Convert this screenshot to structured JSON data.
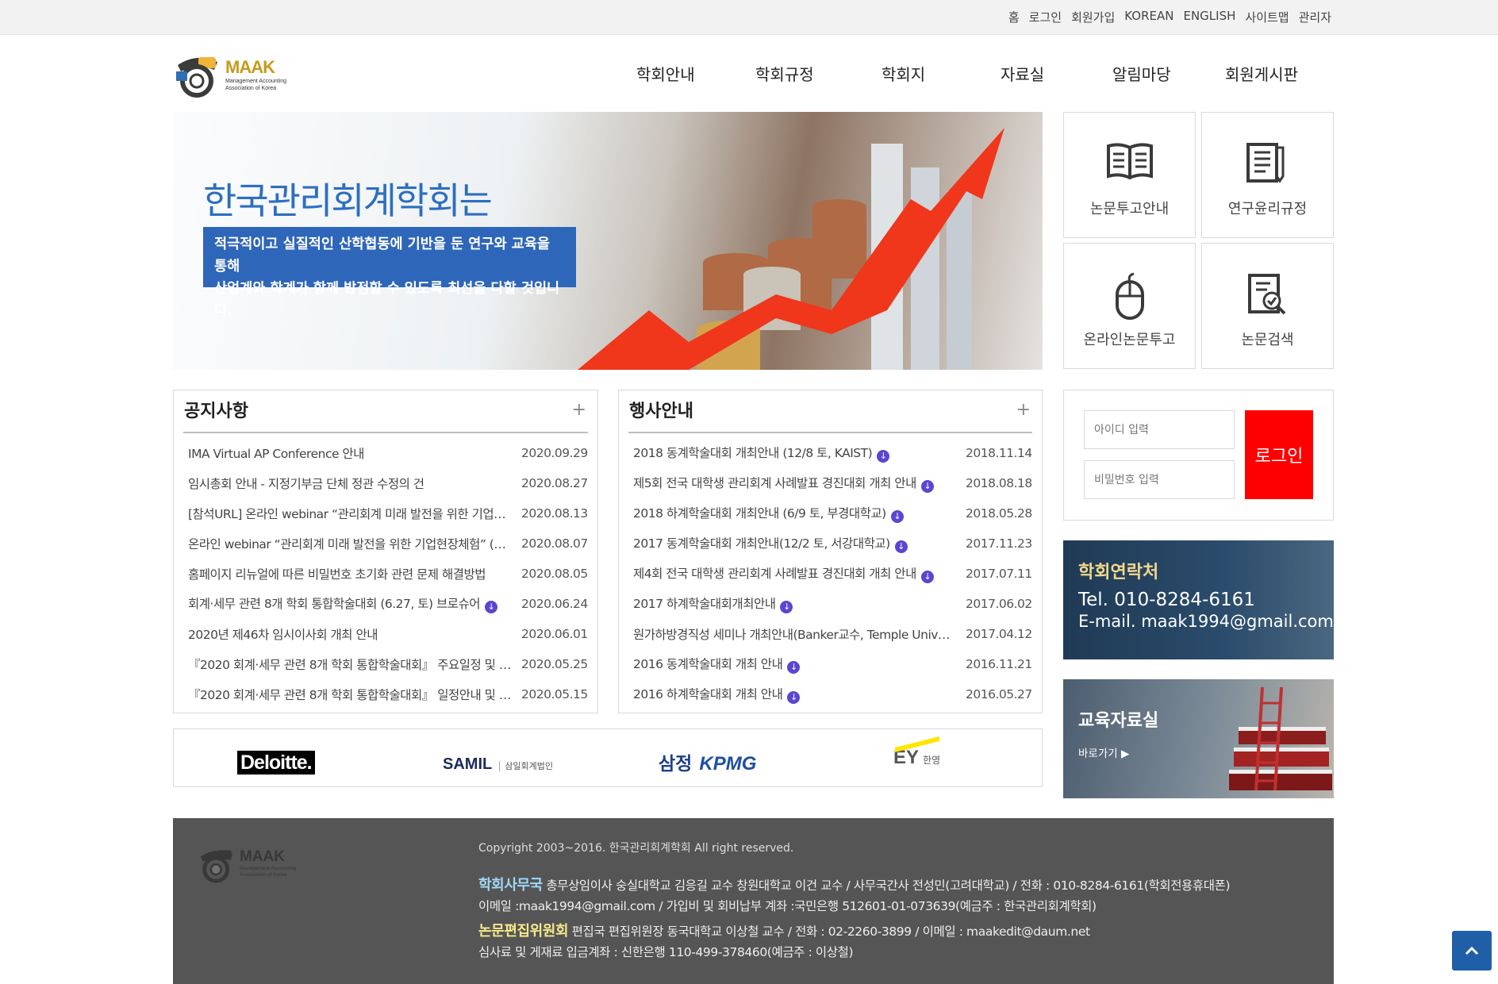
{
  "top_links": [
    "홈",
    "로그인",
    "회원가입",
    "KOREAN",
    "ENGLISH",
    "사이트맵",
    "관리자"
  ],
  "logo": {
    "name": "MAAK",
    "sub1": "Management Accounting",
    "sub2": "Association of Korea"
  },
  "nav": [
    "학회안내",
    "학회규정",
    "학회지",
    "자료실",
    "알림마당",
    "회원게시판"
  ],
  "hero": {
    "title": "한국관리회계학회는",
    "line1": "적극적이고 실질적인 산학협동에 기반을 둔 연구와 교육을 통해",
    "line2": "산업계와 학계가 함께 발전할 수 있도록 최선을 다할 것입니다."
  },
  "quick_links": [
    "논문투고안내",
    "연구윤리규정",
    "온라인논문투고",
    "논문검색"
  ],
  "notice": {
    "title": "공지사항",
    "plus": "+",
    "items": [
      {
        "title": "IMA Virtual AP Conference 안내",
        "date": "2020.09.29"
      },
      {
        "title": "임시총회 안내 - 지정기부금 단체 정관 수정의 건",
        "date": "2020.08.27"
      },
      {
        "title": "[참석URL] 온라인 webinar “관리회계 미래 발전을 위한 기업…",
        "date": "2020.08.13"
      },
      {
        "title": "온라인 webinar “관리회계 미래 발전을 위한 기업현장체험” (…",
        "date": "2020.08.07"
      },
      {
        "title": "홈페이지 리뉴얼에 따른 비밀번호 초기화 관련 문제 해결방법",
        "date": "2020.08.05"
      },
      {
        "title": "회계·세무 관련 8개 학회 통합학술대회 (6.27, 토) 브로슈어",
        "date": "2020.06.24",
        "download": true
      },
      {
        "title": "2020년 제46차 임시이사회 개최 안내",
        "date": "2020.06.01"
      },
      {
        "title": "『2020 회계·세무 관련 8개 학회 통합학술대회』 주요일정 및 …",
        "date": "2020.05.25"
      },
      {
        "title": "『2020 회계·세무 관련 8개 학회 통합학술대회』 일정안내 및 …",
        "date": "2020.05.15"
      }
    ]
  },
  "events": {
    "title": "행사안내",
    "plus": "+",
    "items": [
      {
        "title": "2018 동계학술대회 개최안내 (12/8 토, KAIST)",
        "date": "2018.11.14",
        "download": true
      },
      {
        "title": "제5회 전국 대학생 관리회계 사례발표 경진대회 개최 안내",
        "date": "2018.08.18",
        "download": true
      },
      {
        "title": "2018 하계학술대회 개최안내 (6/9 토, 부경대학교)",
        "date": "2018.05.28",
        "download": true
      },
      {
        "title": "2017 동계학술대회 개최안내(12/2 토, 서강대학교)",
        "date": "2017.11.23",
        "download": true
      },
      {
        "title": "제4회 전국 대학생 관리회계 사례발표 경진대회 개최 안내",
        "date": "2017.07.11",
        "download": true
      },
      {
        "title": "2017 하계학술대회개최안내",
        "date": "2017.06.02",
        "download": true
      },
      {
        "title": "원가하방경직성 세미나 개최안내(Banker교수, Temple Univ…",
        "date": "2017.04.12"
      },
      {
        "title": "2016 동계학술대회 개최 안내",
        "date": "2016.11.21",
        "download": true
      },
      {
        "title": "2016 하계학술대회 개최 안내",
        "date": "2016.05.27",
        "download": true
      }
    ]
  },
  "login": {
    "id_placeholder": "아이디 입력",
    "pw_placeholder": "비밀번호 입력",
    "button": "로그인"
  },
  "contact": {
    "title": "학회연락처",
    "tel": "Tel. 010-8284-6161",
    "email": "E-mail. maak1994@gmail.com"
  },
  "edu": {
    "title": "교육자료실",
    "go": "바로가기 ▶"
  },
  "partners": {
    "deloitte": "Deloitte.",
    "samil": "SAMIL",
    "samil_kr": "삼일회계법인",
    "samjong": "삼정",
    "kpmg": "KPMG",
    "ey": "EY",
    "ey_kr": "한영"
  },
  "footer": {
    "copyright": "Copyright 2003~2016. 한국관리회계학회 All right reserved.",
    "office_label": "학회사무국",
    "office_text": "총무상임이사 숭실대학교 김응길 교수 창원대학교 이건 교수 / 사무국간사 전성민(고려대학교) / 전화 : 010-8284-6161(학회전용휴대폰)",
    "office_text2": "이메일 :maak1994@gmail.com / 가입비 및 회비납부 계좌 :국민은행 512601-01-073639(예금주 : 한국관리회계학회)",
    "editor_label": "논문편집위원회",
    "editor_text": "편집국 편집위원장 동국대학교 이상철 교수 / 전화 : 02-2260-3899 / 이메일 : maakedit@daum.net",
    "editor_text2": "심사료 및 게재료 입금계좌 : 신한은행 110-499-378460(예금주 : 이상철)"
  },
  "colors": {
    "accent_blue": "#2e66b9",
    "login_red": "#ff0000",
    "download_purple": "#5b46d1",
    "footer_gray": "#555555"
  }
}
